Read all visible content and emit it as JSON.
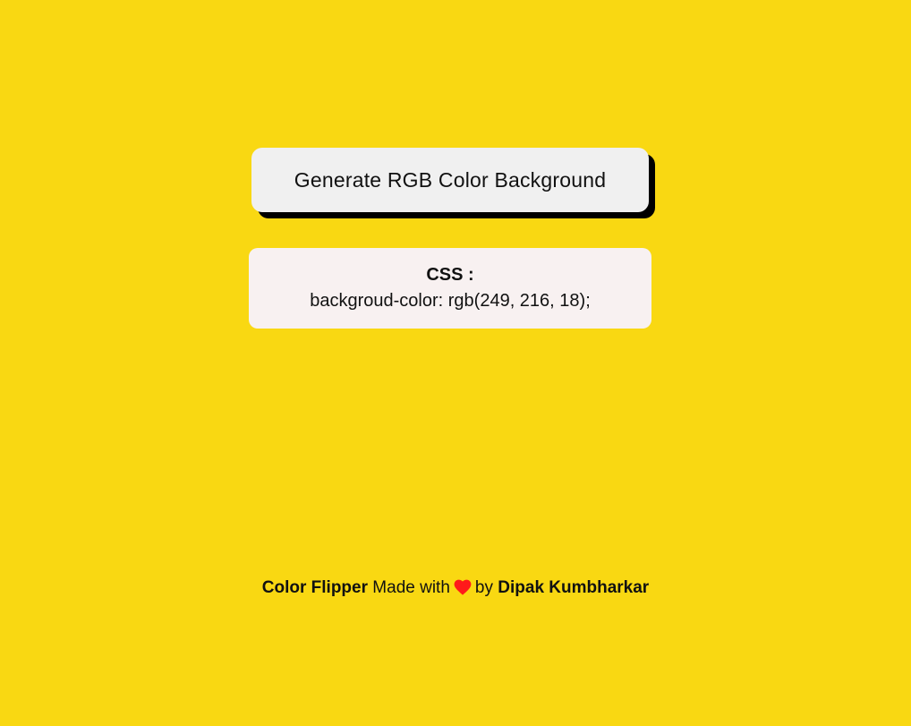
{
  "background_color": "#f9d812",
  "generate_button": {
    "label": "Generate RGB Color Background"
  },
  "css_box": {
    "title": "CSS :",
    "code": "backgroud-color: rgb(249, 216, 18);"
  },
  "footer": {
    "app_name": "Color Flipper",
    "made_with": "Made with",
    "heart_icon": "heart-icon",
    "heart_color": "#ff1a1a",
    "by": "by",
    "author": "Dipak Kumbharkar"
  }
}
